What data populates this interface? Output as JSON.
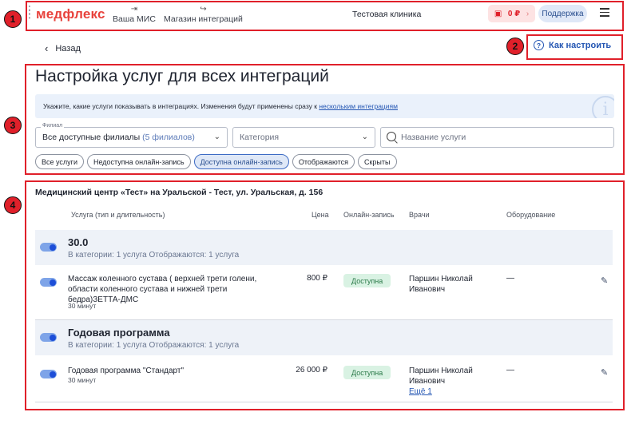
{
  "header": {
    "logo": "медфлекс",
    "nav": [
      {
        "icon": "login-icon",
        "label": "Ваша МИС"
      },
      {
        "icon": "logout-icon",
        "label": "Магазин интеграций"
      }
    ],
    "clinic": "Тестовая клиника",
    "balance": "0 ₽",
    "support": "Поддержка"
  },
  "back_label": "Назад",
  "howto_label": "Как настроить",
  "page_title": "Настройка услуг для всех интеграций",
  "info": {
    "text": "Укажите, какие услуги показывать в интеграциях. Изменения будут применены сразу к ",
    "link": "нескольким интеграциям"
  },
  "filters": {
    "branch_label": "Филиал",
    "branch_value": "Все доступные филиалы",
    "branch_count": "(5 филиалов)",
    "category_placeholder": "Категория",
    "search_placeholder": "Название услуги"
  },
  "chips": [
    {
      "label": "Все услуги",
      "active": false
    },
    {
      "label": "Недоступна онлайн-запись",
      "active": false
    },
    {
      "label": "Доступна онлайн-запись",
      "active": true
    },
    {
      "label": "Отображаются",
      "active": false
    },
    {
      "label": "Скрыты",
      "active": false
    }
  ],
  "center_title": "Медицинский центр «Тест» на Уральской - Тест, ул. Уральская, д. 156",
  "columns": {
    "service": "Услуга (тип и длительность)",
    "price": "Цена",
    "online": "Онлайн-запись",
    "doctors": "Врачи",
    "equipment": "Оборудование"
  },
  "groups": [
    {
      "name": "30.0",
      "meta": "В категории: 1 услуга   Отображаются: 1 услуга",
      "service": {
        "name": "Массаж коленного сустава ( верхней трети голени, области коленного сустава и нижней трети бедра)ЗЕТТА-ДМС",
        "duration": "30 минут",
        "price": "800 ₽",
        "status": "Доступна",
        "doctor": "Паршин Николай Иванович",
        "more": "",
        "equipment": "—"
      }
    },
    {
      "name": "Годовая программа",
      "meta": "В категории: 1 услуга   Отображаются: 1 услуга",
      "service": {
        "name": "Годовая программа \"Стандарт\"",
        "duration": "30 минут",
        "price": "26 000 ₽",
        "status": "Доступна",
        "doctor": "Паршин Николай Иванович",
        "more": "Ещё 1",
        "equipment": "—"
      }
    }
  ],
  "annotations": [
    "1",
    "2",
    "3",
    "4"
  ],
  "colors": {
    "accent": "#2456b3",
    "brand": "#e8423c",
    "highlight": "#e0202a"
  }
}
